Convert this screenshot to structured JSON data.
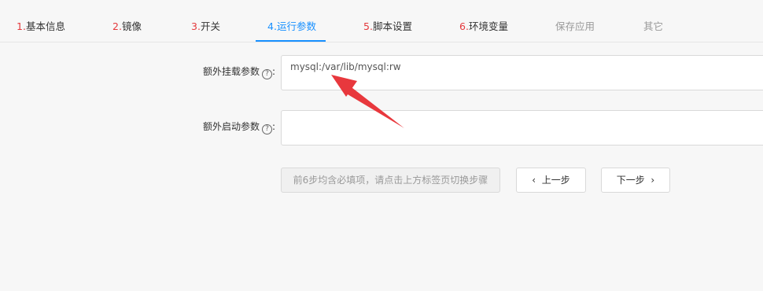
{
  "tabs": [
    {
      "num": "1.",
      "label": "基本信息"
    },
    {
      "num": "2.",
      "label": "镜像"
    },
    {
      "num": "3.",
      "label": "开关"
    },
    {
      "num": "4.",
      "label": "运行参数"
    },
    {
      "num": "5.",
      "label": "脚本设置"
    },
    {
      "num": "6.",
      "label": "环境变量"
    },
    {
      "label": "保存应用"
    },
    {
      "label": "其它"
    }
  ],
  "form": {
    "extra_mount": {
      "label": "额外挂载参数",
      "colon": ":",
      "value": "mysql:/var/lib/mysql:rw"
    },
    "extra_start": {
      "label": "额外启动参数",
      "colon": ":",
      "value": ""
    }
  },
  "buttons": {
    "hint": "前6步均含必填项，请点击上方标签页切换步骤",
    "prev": "上一步",
    "next": "下一步"
  },
  "icons": {
    "help": "question-circle-icon",
    "prev": "chevron-left-icon",
    "next": "chevron-right-icon"
  },
  "colors": {
    "active_tab": "#1890ff",
    "step_number": "#e4393c",
    "annotation_arrow": "#e8383d"
  }
}
